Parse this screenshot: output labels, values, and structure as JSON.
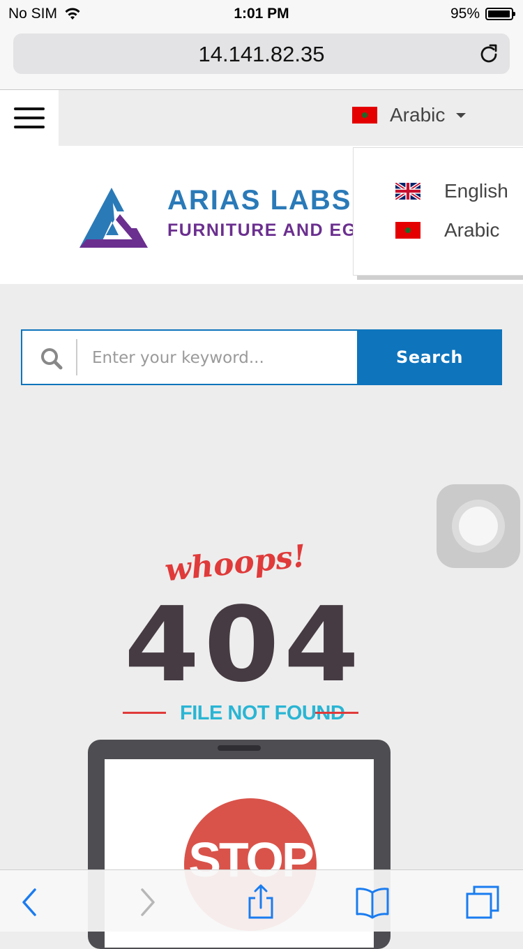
{
  "status_bar": {
    "carrier": "No SIM",
    "time": "1:01 PM",
    "battery": "95%",
    "battery_level": 0.95
  },
  "browser": {
    "url": "14.141.82.35"
  },
  "nav": {
    "current_language": "Arabic",
    "languages": [
      {
        "label": "English",
        "flag": "uk-flag-icon"
      },
      {
        "label": "Arabic",
        "flag": "morocco-flag-icon"
      }
    ]
  },
  "brand": {
    "name": "ARIAS LABS S",
    "tagline": "FURNITURE AND EG"
  },
  "search": {
    "placeholder": "Enter your keyword...",
    "button_label": "Search"
  },
  "error": {
    "whoops": "whoops!",
    "code": "404",
    "message": "FILE NOT FOUND",
    "stop": "STOP"
  },
  "colors": {
    "accent": "#0e74bc",
    "brand_blue": "#2a7ab8",
    "brand_purple": "#6b2f8f",
    "error_red": "#e03a3a",
    "error_dark": "#463b42",
    "error_cyan": "#2ab5d4"
  }
}
